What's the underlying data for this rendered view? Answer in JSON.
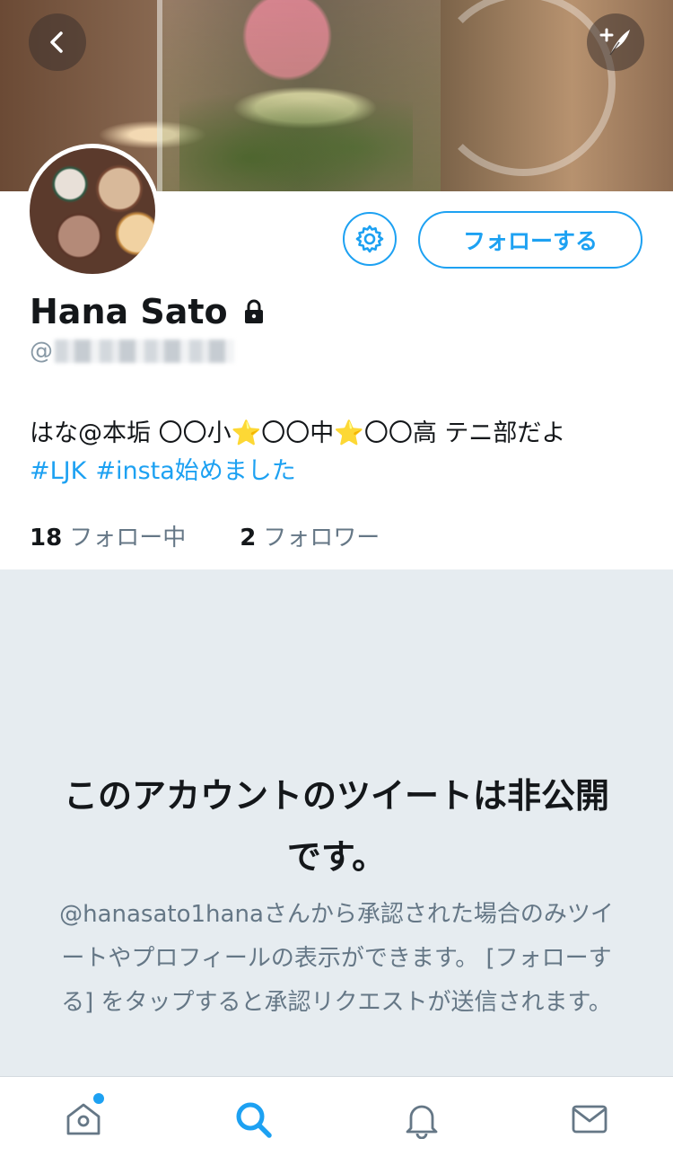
{
  "profile": {
    "name": "Hana Sato",
    "handle_prefix": "@",
    "bio_text": "はな@本垢 〇〇小⭐️〇〇中⭐️〇〇高 テニ部だよ",
    "bio_tags": [
      "#LJK",
      "#insta始めました"
    ],
    "following_count": "18",
    "following_label": "フォロー中",
    "followers_count": "2",
    "followers_label": "フォロワー"
  },
  "actions": {
    "follow_label": "フォローする"
  },
  "protected": {
    "title": "このアカウントのツイートは非公開です。",
    "description": "@hanasato1hanaさんから承認された場合のみツイートやプロフィールの表示ができます。 [フォローする] をタップすると承認リクエストが送信されます。"
  },
  "icons": {
    "back": "chevron-left-icon",
    "compose": "compose-icon",
    "settings": "gear-icon",
    "lock": "lock-icon",
    "home": "home-icon",
    "search": "search-icon",
    "notifications": "bell-icon",
    "messages": "mail-icon"
  },
  "colors": {
    "accent": "#1da1f2",
    "panel_bg": "#e6ecf0",
    "muted_text": "#657786"
  }
}
